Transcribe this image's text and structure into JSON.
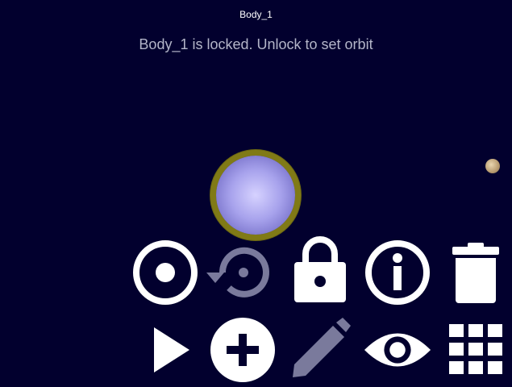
{
  "header": {
    "title": "Body_1",
    "status": "Body_1 is locked. Unlock to set orbit"
  },
  "scene": {
    "bodies": [
      {
        "name": "Body_1",
        "color": "#a7a2ec",
        "ring_color": "#807a16",
        "state": "locked"
      },
      {
        "name": "moon",
        "color": "#b89b70"
      }
    ]
  },
  "toolbar": {
    "row1": [
      {
        "icon": "target-icon",
        "enabled": true
      },
      {
        "icon": "reset-orbit-icon",
        "enabled": false
      },
      {
        "icon": "lock-icon",
        "enabled": true
      },
      {
        "icon": "info-icon",
        "enabled": true
      },
      {
        "icon": "trash-icon",
        "enabled": true
      }
    ],
    "row2": [
      {
        "icon": "play-icon",
        "enabled": true
      },
      {
        "icon": "add-icon",
        "enabled": true
      },
      {
        "icon": "pencil-icon",
        "enabled": false
      },
      {
        "icon": "eye-icon",
        "enabled": true
      },
      {
        "icon": "grid-icon",
        "enabled": true
      }
    ]
  },
  "colors": {
    "background": "#02002e",
    "icon_enabled": "#ffffff",
    "icon_disabled": "#7a7a9c",
    "status_text": "#b3b5c8"
  }
}
